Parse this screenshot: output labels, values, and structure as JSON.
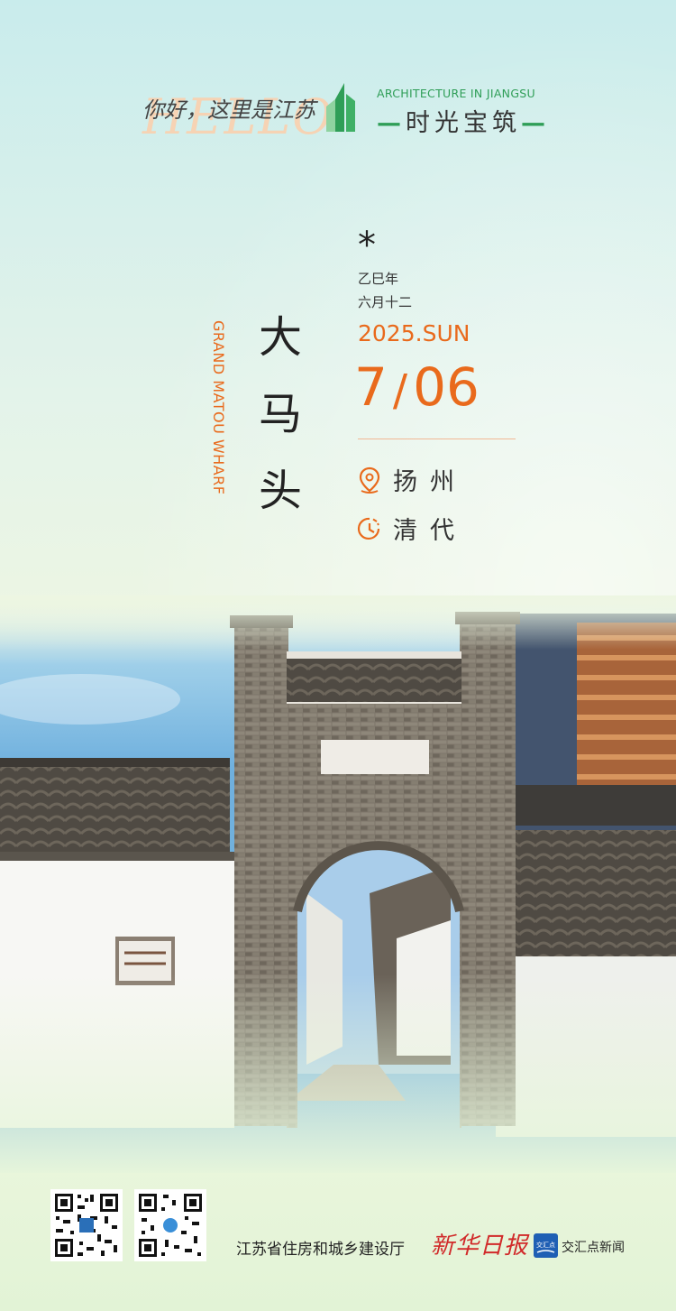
{
  "header": {
    "hello_script": "HELLO",
    "hello_cn": "你好，这里是江苏",
    "brand_en": "ARCHITECTURE IN JIANGSU",
    "brand_cn": "时光宝筑",
    "brand_dash": "—",
    "brand_color": "#2f9e57"
  },
  "title": {
    "en": "GRAND MATOU WHARF",
    "cn_chars": [
      "大",
      "马",
      "头"
    ]
  },
  "date": {
    "asterisk": "*",
    "lunar_year": "乙巳年",
    "lunar_day": "六月十二",
    "year_weekday": "2025.SUN",
    "month": "7",
    "slash": "/",
    "day": "06",
    "accent_color": "#e96a1c"
  },
  "info": {
    "location_icon": "location-pin-icon",
    "location": "扬州",
    "period_icon": "clock-icon",
    "period": "清代"
  },
  "footer": {
    "org": "江苏省住房和城乡建设厅",
    "newspaper": "新华日报",
    "app_logo_text": "交汇点",
    "app_name": "交汇点新闻"
  }
}
